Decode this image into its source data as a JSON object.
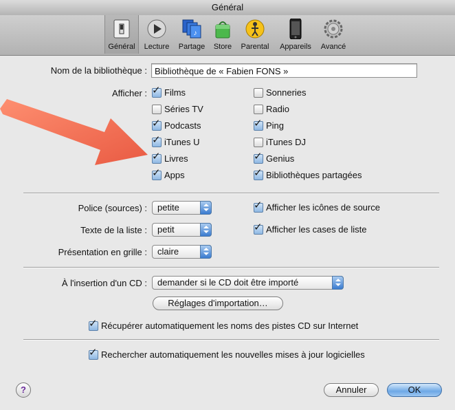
{
  "window": {
    "title": "Général"
  },
  "toolbar": {
    "items": [
      {
        "label": "Général",
        "icon": "switch-icon",
        "selected": true
      },
      {
        "label": "Lecture",
        "icon": "play-icon"
      },
      {
        "label": "Partage",
        "icon": "sharing-icon"
      },
      {
        "label": "Store",
        "icon": "store-bag-icon"
      },
      {
        "label": "Parental",
        "icon": "parental-icon"
      },
      {
        "label": "Appareils",
        "icon": "iphone-icon"
      },
      {
        "label": "Avancé",
        "icon": "gear-icon"
      }
    ]
  },
  "library": {
    "label": "Nom de la bibliothèque :",
    "value": "Bibliothèque de « Fabien FONS »"
  },
  "show": {
    "label": "Afficher :",
    "left": [
      {
        "label": "Films",
        "checked": true
      },
      {
        "label": "Séries TV",
        "checked": false
      },
      {
        "label": "Podcasts",
        "checked": true
      },
      {
        "label": "iTunes U",
        "checked": true
      },
      {
        "label": "Livres",
        "checked": true
      },
      {
        "label": "Apps",
        "checked": true
      }
    ],
    "right": [
      {
        "label": "Sonneries",
        "checked": false
      },
      {
        "label": "Radio",
        "checked": false
      },
      {
        "label": "Ping",
        "checked": true
      },
      {
        "label": "iTunes DJ",
        "checked": false
      },
      {
        "label": "Genius",
        "checked": true
      },
      {
        "label": "Bibliothèques partagées",
        "checked": true
      }
    ]
  },
  "fonts": {
    "source_label": "Police (sources) :",
    "source_value": "petite",
    "list_label": "Texte de la liste :",
    "list_value": "petit",
    "grid_label": "Présentation en grille :",
    "grid_value": "claire",
    "show_source_icons": "Afficher les icônes de source",
    "show_list_checkboxes": "Afficher les cases de liste"
  },
  "cd": {
    "label": "À l'insertion d'un CD :",
    "value": "demander si le CD doit être importé",
    "import_button": "Réglages d'importation…",
    "fetch_names": "Récupérer automatiquement les noms des pistes CD sur Internet"
  },
  "updates": {
    "label": "Rechercher automatiquement les nouvelles mises à jour logicielles"
  },
  "footer": {
    "help": "?",
    "cancel": "Annuler",
    "ok": "OK"
  },
  "colors": {
    "arrow": "#f26a4b",
    "accent": "#3b7cd0"
  }
}
